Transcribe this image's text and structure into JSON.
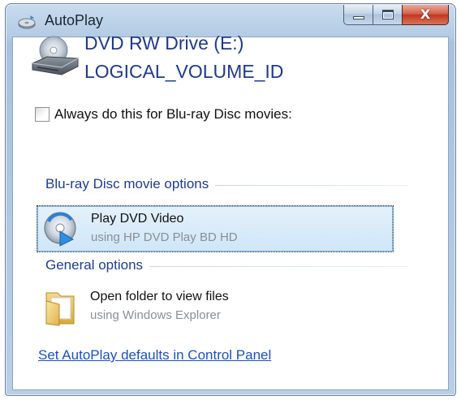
{
  "window": {
    "title": "AutoPlay",
    "caption_buttons": {
      "minimize_icon": "minimize-icon",
      "maximize_icon": "maximize-icon",
      "close_glyph": "X"
    }
  },
  "device": {
    "drive_name": "DVD RW Drive (E:)",
    "volume_id": "LOGICAL_VOLUME_ID",
    "icon": "dvd-drive-icon"
  },
  "always": {
    "label": "Always do this for Blu-ray Disc movies:",
    "checked": false
  },
  "sections": {
    "bluray": {
      "header": "Blu-ray Disc movie options",
      "options": [
        {
          "title": "Play DVD Video",
          "subtitle": "using HP DVD Play BD HD",
          "icon": "play-disc-icon",
          "selected": true
        }
      ]
    },
    "general": {
      "header": "General options",
      "options": [
        {
          "title": "Open folder to view files",
          "subtitle": "using Windows Explorer",
          "icon": "folder-icon",
          "selected": false
        }
      ]
    }
  },
  "footer": {
    "defaults_link": "Set AutoPlay defaults in Control Panel"
  },
  "colors": {
    "accent_text": "#1f3a8a",
    "link": "#1d4fbf",
    "selection_bg": "#cfe6f7",
    "close_button": "#c1381f"
  }
}
